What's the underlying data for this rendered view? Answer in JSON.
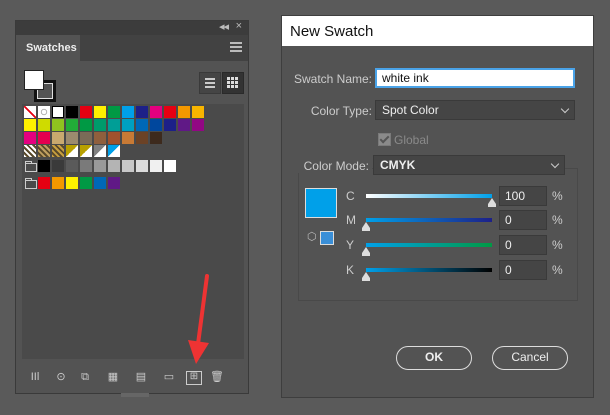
{
  "panel": {
    "collapse_glyph": "◂◂",
    "close_glyph": "×",
    "tab_label": "Swatches",
    "swatch_rows": [
      [
        "#ffffff|none",
        "#ffffff|reg",
        "#ffffff|white",
        "#000000",
        "#e60012",
        "#fff100",
        "#009944",
        "#00a0e9",
        "#1d2088",
        "#e4007f",
        "#e60012",
        "#f39800",
        "#f8b500"
      ],
      [
        "#fff100",
        "#cfdb00",
        "#8fc31f",
        "#22ac38",
        "#009944",
        "#009b6b",
        "#009e96",
        "#00a0c1",
        "#0068b7",
        "#00479d",
        "#1d2088",
        "#601986",
        "#920783"
      ],
      [
        "#e4007f",
        "#e5004f",
        "#c9a96e",
        "#9c8b6e",
        "#7a6b57",
        "#8f5f3d",
        "#a0522d",
        "#c87a35",
        "#6b4226",
        "#3d2a1d"
      ],
      [
        "#ffffff|pat",
        "#c0a060|pat",
        "#c8a040|pat",
        "#b8a000|grad",
        "#b8a000|grad",
        "#808080|grad",
        "#00a0e9|grad"
      ],
      [
        "folder",
        "#000000",
        "#3a3a3a",
        "#5a5a5a",
        "#7a7a7a",
        "#9a9a9a",
        "#b4b4b4",
        "#c8c8c8",
        "#dcdcdc",
        "#f0f0f0",
        "#ffffff"
      ],
      [
        "folder",
        "#e60012",
        "#f39800",
        "#fff100",
        "#009944",
        "#0068b7",
        "#601986"
      ]
    ],
    "extra_row_colors": [
      "#e60012",
      "#f39800",
      "#fff100",
      "#a6c400",
      "#f5a0a0",
      "#f0c060",
      "#5bbde0",
      "#c0c0c0"
    ],
    "toolbar_icons": [
      "library-icon",
      "place-swatch-icon",
      "show-kinds-icon",
      "swatch-options-icon",
      "color-group-icon",
      "new-folder-icon",
      "new-swatch-icon",
      "delete-icon"
    ]
  },
  "dialog": {
    "title": "New Swatch",
    "swatch_name_label": "Swatch Name:",
    "swatch_name_value": "white ink",
    "color_type_label": "Color Type:",
    "color_type_value": "Spot Color",
    "global_label": "Global",
    "global_checked": true,
    "color_mode_label": "Color Mode:",
    "color_mode_value": "CMYK",
    "preview_color": "#00a0e9",
    "channels": [
      {
        "label": "C",
        "value": "100",
        "fraction": 1.0,
        "gradient": [
          "#ffffff",
          "#00a0e9"
        ]
      },
      {
        "label": "M",
        "value": "0",
        "fraction": 0.0,
        "gradient": [
          "#00a0e9",
          "#1d2088"
        ]
      },
      {
        "label": "Y",
        "value": "0",
        "fraction": 0.0,
        "gradient": [
          "#00a0e9",
          "#009944"
        ]
      },
      {
        "label": "K",
        "value": "0",
        "fraction": 0.0,
        "gradient": [
          "#00a0e9",
          "#000000"
        ]
      }
    ],
    "percent_sign": "%",
    "ok_label": "OK",
    "cancel_label": "Cancel"
  }
}
